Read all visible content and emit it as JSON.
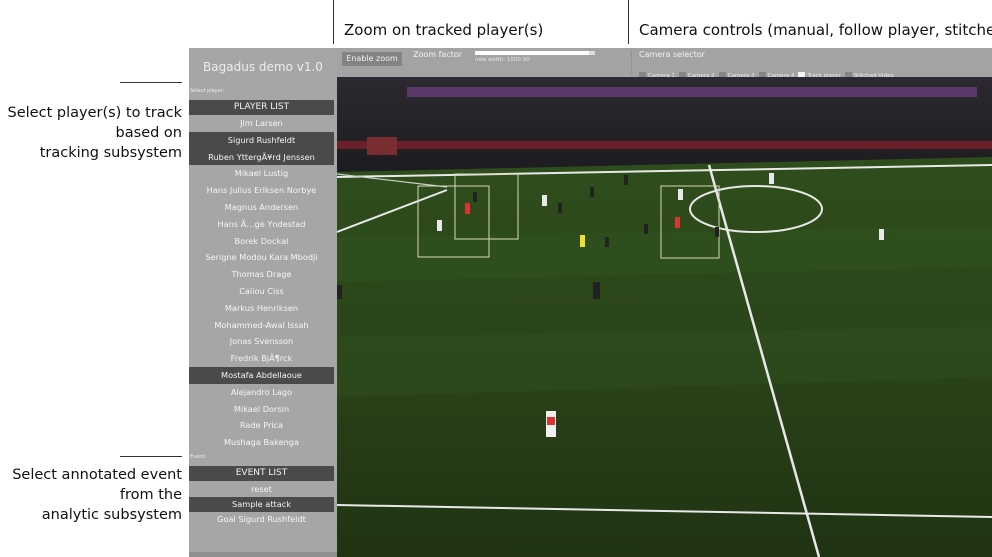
{
  "callouts": {
    "top_zoom": "Zoom on tracked player(s)",
    "top_camera": "Camera controls (manual, follow player, stitched)",
    "left_players": [
      "Select player(s) to track",
      "based on",
      "tracking subsystem"
    ],
    "left_events": [
      "Select annotated event",
      "from the",
      "analytic subsystem"
    ]
  },
  "app": {
    "title": "Bagadus demo v1.0",
    "select_player_label": "Select player:",
    "player_list_header": "PLAYER LIST",
    "players": [
      {
        "name": "Jim Larsen",
        "selected": false
      },
      {
        "name": "Sigurd Rushfeldt",
        "selected": true
      },
      {
        "name": "Ruben YttergÃ¥rd Jenssen",
        "selected": true
      },
      {
        "name": "Mikael Lustig",
        "selected": false
      },
      {
        "name": "Hans Julius Eriksen Norbye",
        "selected": false
      },
      {
        "name": "Magnus Andersen",
        "selected": false
      },
      {
        "name": "Hans Ã…ge Yndestad",
        "selected": false
      },
      {
        "name": "Borek Dockal",
        "selected": false
      },
      {
        "name": "Serigne Modou Kara Mbodji",
        "selected": false
      },
      {
        "name": "Thomas Drage",
        "selected": false
      },
      {
        "name": "Caliou Ciss",
        "selected": false
      },
      {
        "name": "Markus Henriksen",
        "selected": false
      },
      {
        "name": "Mohammed-Awal Issah",
        "selected": false
      },
      {
        "name": "Jonas Svensson",
        "selected": false
      },
      {
        "name": "Fredrik BjÃ¶rck",
        "selected": false
      },
      {
        "name": "Mostafa Abdellaoue",
        "selected": true
      },
      {
        "name": "Alejandro Lago",
        "selected": false
      },
      {
        "name": "Mikael Dorsin",
        "selected": false
      },
      {
        "name": "Rade Prica",
        "selected": false
      },
      {
        "name": "Mushaga Bakenga",
        "selected": false
      }
    ],
    "event_label": "Event:",
    "event_list_header": "EVENT LIST",
    "events": [
      {
        "name": "reset",
        "selected": false
      },
      {
        "name": "Sample attack",
        "selected": true
      },
      {
        "name": "Goal Sigurd Rushfeldt",
        "selected": false
      }
    ],
    "zoom": {
      "button_label": "Enable zoom",
      "factor_label": "Zoom factor",
      "value_text": "new width: 1000.00",
      "slider_fraction": 0.95
    },
    "camera": {
      "title": "Camera selector",
      "options": [
        {
          "label": "Camera 1",
          "checked": false
        },
        {
          "label": "Camera 2",
          "checked": false
        },
        {
          "label": "Camera 3",
          "checked": false
        },
        {
          "label": "Camera 4",
          "checked": false
        },
        {
          "label": "Track player",
          "checked": true
        },
        {
          "label": "Stitched Video",
          "checked": false
        }
      ]
    }
  },
  "colors": {
    "sidebar_bg": "#a6a6a6",
    "selected_row": "#4a4a4a",
    "pitch_green": "#2c4a1a"
  }
}
